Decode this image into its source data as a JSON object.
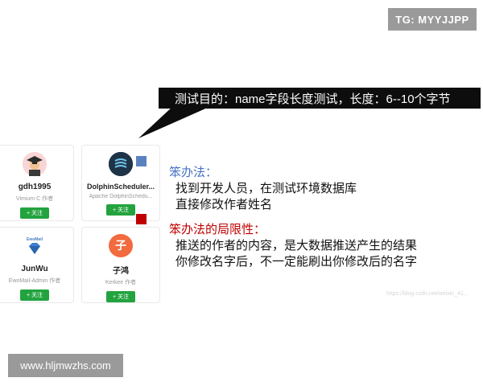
{
  "badge": {
    "text": "TG: MYYJJPP"
  },
  "callout": {
    "text": "测试目的：name字段长度测试，长度：6--10个字节"
  },
  "cards": [
    {
      "name": "gdh1995",
      "desc": "Vimium C 作者",
      "follow": "+ 关注"
    },
    {
      "name": "DolphinScheduler...",
      "desc": "Apache DolphinSchedu...",
      "follow": "+ 关注"
    },
    {
      "name": "JunWu",
      "desc": "EwoMail-Admin 作者",
      "follow": "+ 关注",
      "logo_text": "EwoMail"
    },
    {
      "name": "子鸿",
      "desc": "Kerkee 作者",
      "follow": "+ 关注",
      "avatar_char": "子"
    }
  ],
  "notes": {
    "method_title": "笨办法：",
    "method_lines": [
      "找到开发人员，在测试环境数据库",
      "直接修改作者姓名"
    ],
    "limit_title": "笨办法的局限性：",
    "limit_lines": [
      "推送的作者的内容，是大数据推送产生的结果",
      "你修改名字后，不一定能刷出你修改后的名字"
    ]
  },
  "watermark": "https://blog.csdn.net/weixin_41...",
  "site": {
    "text": "www.hljmwzhs.com"
  },
  "colors": {
    "follow_green": "#23a33f",
    "blue_square": "#5b82c0",
    "red_square": "#c00000",
    "orange_avatar": "#f26a3d"
  }
}
